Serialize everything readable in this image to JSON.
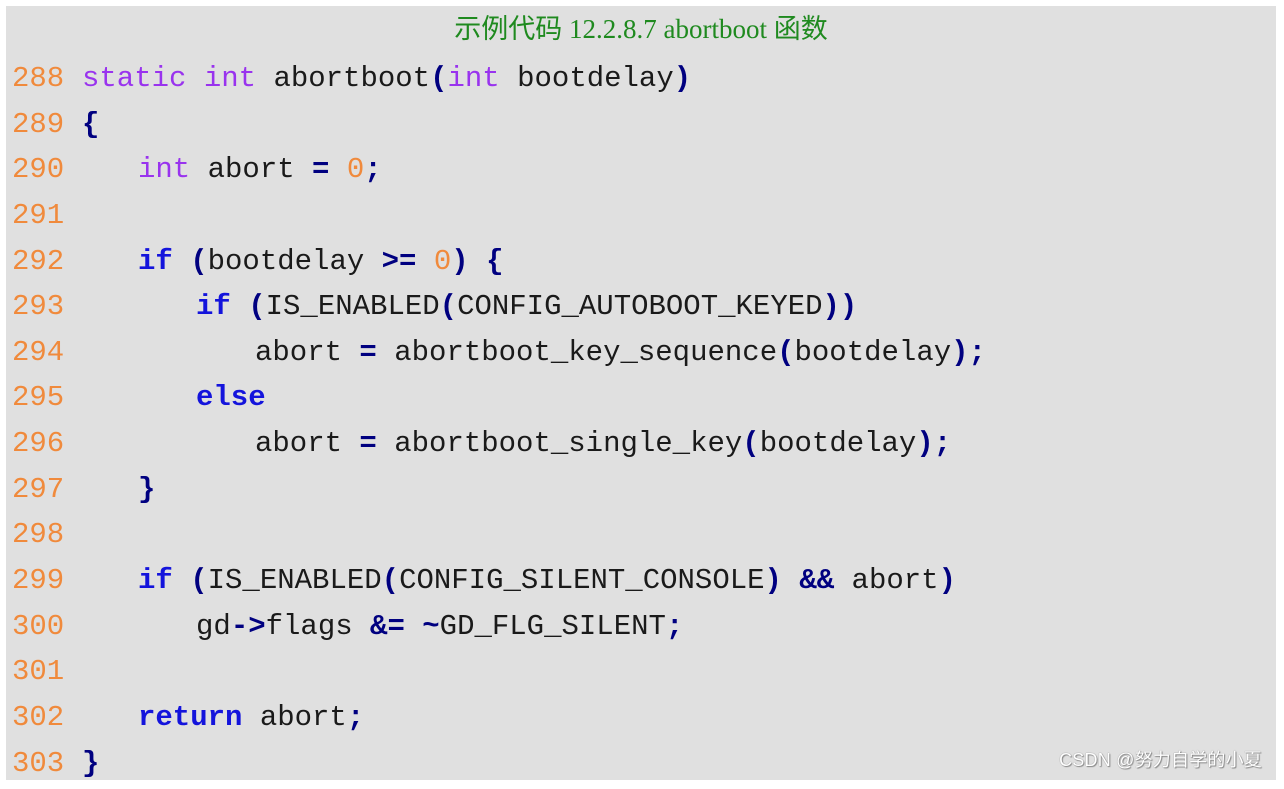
{
  "caption": "示例代码 12.2.8.7 abortboot 函数",
  "watermark": "CSDN @努力自学的小夏",
  "colors": {
    "background": "#e0e0e0",
    "caption": "#1f8a1f",
    "line_number": "#f08a3c",
    "type_keyword": "#9933ee",
    "control_keyword": "#1414dc",
    "operator": "#000080",
    "number": "#f08a3c",
    "identifier": "#1a1a1a"
  },
  "code_lines": [
    {
      "number": "288",
      "indent": 0,
      "tokens": [
        {
          "t": "type",
          "v": "static"
        },
        {
          "t": "id",
          "v": " "
        },
        {
          "t": "type",
          "v": "int"
        },
        {
          "t": "id",
          "v": " abortboot"
        },
        {
          "t": "op",
          "v": "("
        },
        {
          "t": "type",
          "v": "int"
        },
        {
          "t": "id",
          "v": " bootdelay"
        },
        {
          "t": "op",
          "v": ")"
        }
      ]
    },
    {
      "number": "289",
      "indent": 0,
      "tokens": [
        {
          "t": "op",
          "v": "{"
        }
      ]
    },
    {
      "number": "290",
      "indent": 1,
      "tokens": [
        {
          "t": "type",
          "v": "int"
        },
        {
          "t": "id",
          "v": " abort "
        },
        {
          "t": "op",
          "v": "="
        },
        {
          "t": "id",
          "v": " "
        },
        {
          "t": "num",
          "v": "0"
        },
        {
          "t": "op",
          "v": ";"
        }
      ]
    },
    {
      "number": "291",
      "indent": 0,
      "tokens": []
    },
    {
      "number": "292",
      "indent": 1,
      "tokens": [
        {
          "t": "kw",
          "v": "if"
        },
        {
          "t": "id",
          "v": " "
        },
        {
          "t": "op",
          "v": "("
        },
        {
          "t": "id",
          "v": "bootdelay "
        },
        {
          "t": "op",
          "v": ">="
        },
        {
          "t": "id",
          "v": " "
        },
        {
          "t": "num",
          "v": "0"
        },
        {
          "t": "op",
          "v": ")"
        },
        {
          "t": "id",
          "v": " "
        },
        {
          "t": "op",
          "v": "{"
        }
      ]
    },
    {
      "number": "293",
      "indent": 2,
      "tokens": [
        {
          "t": "kw",
          "v": "if"
        },
        {
          "t": "id",
          "v": " "
        },
        {
          "t": "op",
          "v": "("
        },
        {
          "t": "id",
          "v": "IS_ENABLED"
        },
        {
          "t": "op",
          "v": "("
        },
        {
          "t": "id",
          "v": "CONFIG_AUTOBOOT_KEYED"
        },
        {
          "t": "op",
          "v": "))"
        }
      ]
    },
    {
      "number": "294",
      "indent": 3,
      "tokens": [
        {
          "t": "id",
          "v": "abort "
        },
        {
          "t": "op",
          "v": "="
        },
        {
          "t": "id",
          "v": " abortboot_key_sequence"
        },
        {
          "t": "op",
          "v": "("
        },
        {
          "t": "id",
          "v": "bootdelay"
        },
        {
          "t": "op",
          "v": ");"
        }
      ]
    },
    {
      "number": "295",
      "indent": 2,
      "tokens": [
        {
          "t": "kw",
          "v": "else"
        }
      ]
    },
    {
      "number": "296",
      "indent": 3,
      "tokens": [
        {
          "t": "id",
          "v": "abort "
        },
        {
          "t": "op",
          "v": "="
        },
        {
          "t": "id",
          "v": " abortboot_single_key"
        },
        {
          "t": "op",
          "v": "("
        },
        {
          "t": "id",
          "v": "bootdelay"
        },
        {
          "t": "op",
          "v": ");"
        }
      ]
    },
    {
      "number": "297",
      "indent": 1,
      "tokens": [
        {
          "t": "op",
          "v": "}"
        }
      ]
    },
    {
      "number": "298",
      "indent": 0,
      "tokens": []
    },
    {
      "number": "299",
      "indent": 1,
      "tokens": [
        {
          "t": "kw",
          "v": "if"
        },
        {
          "t": "id",
          "v": " "
        },
        {
          "t": "op",
          "v": "("
        },
        {
          "t": "id",
          "v": "IS_ENABLED"
        },
        {
          "t": "op",
          "v": "("
        },
        {
          "t": "id",
          "v": "CONFIG_SILENT_CONSOLE"
        },
        {
          "t": "op",
          "v": ")"
        },
        {
          "t": "id",
          "v": " "
        },
        {
          "t": "op",
          "v": "&&"
        },
        {
          "t": "id",
          "v": " abort"
        },
        {
          "t": "op",
          "v": ")"
        }
      ]
    },
    {
      "number": "300",
      "indent": 2,
      "tokens": [
        {
          "t": "id",
          "v": "gd"
        },
        {
          "t": "op",
          "v": "->"
        },
        {
          "t": "id",
          "v": "flags "
        },
        {
          "t": "op",
          "v": "&="
        },
        {
          "t": "id",
          "v": " "
        },
        {
          "t": "op",
          "v": "~"
        },
        {
          "t": "id",
          "v": "GD_FLG_SILENT"
        },
        {
          "t": "op",
          "v": ";"
        }
      ]
    },
    {
      "number": "301",
      "indent": 0,
      "tokens": []
    },
    {
      "number": "302",
      "indent": 1,
      "tokens": [
        {
          "t": "kw",
          "v": "return"
        },
        {
          "t": "id",
          "v": " abort"
        },
        {
          "t": "op",
          "v": ";"
        }
      ]
    },
    {
      "number": "303",
      "indent": 0,
      "tokens": [
        {
          "t": "op",
          "v": "}"
        }
      ]
    }
  ]
}
